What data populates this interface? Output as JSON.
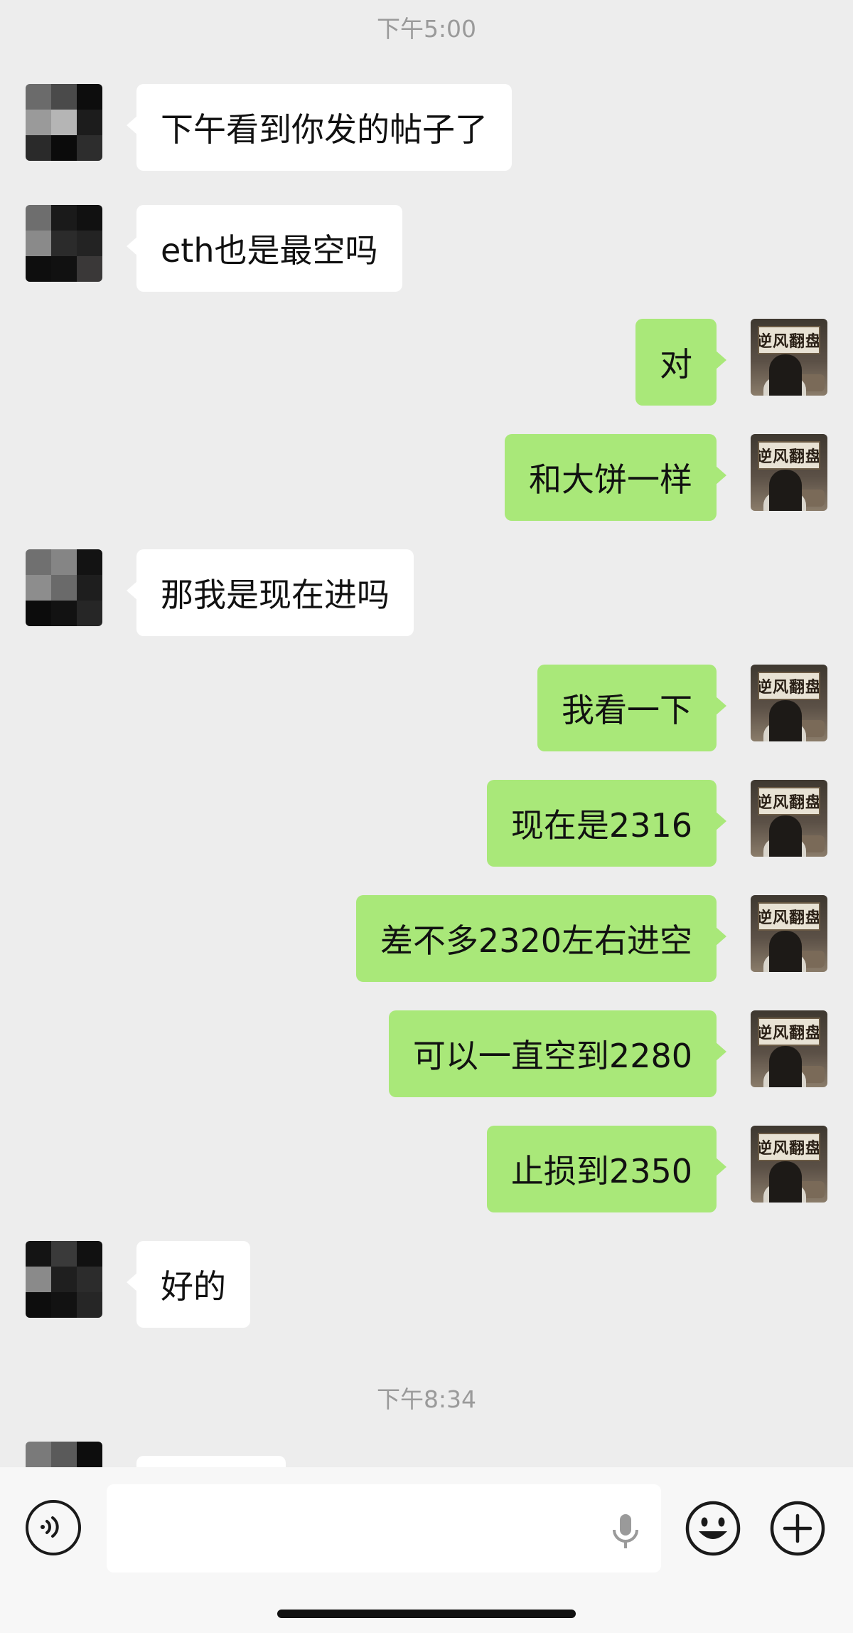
{
  "timestamps": [
    "下午5:00",
    "下午8:34"
  ],
  "messages": [
    {
      "side": "left",
      "text": "下午看到你发的帖子了"
    },
    {
      "side": "left",
      "text": "eth也是最空吗"
    },
    {
      "side": "right",
      "text": "对"
    },
    {
      "side": "right",
      "text": "和大饼一样"
    },
    {
      "side": "left",
      "text": "那我是现在进吗"
    },
    {
      "side": "right",
      "text": "我看一下"
    },
    {
      "side": "right",
      "text": "现在是2316"
    },
    {
      "side": "right",
      "text": "差不多2320左右进空"
    },
    {
      "side": "right",
      "text": "可以一直空到2280"
    },
    {
      "side": "right",
      "text": "止损到2350"
    },
    {
      "side": "left",
      "text": "好的"
    }
  ],
  "self_avatar": {
    "banner_text": "逆风翻盘"
  },
  "input_bar": {
    "icons": [
      "voice-icon",
      "microphone-icon",
      "emoji-icon",
      "plus-icon"
    ],
    "placeholder": ""
  },
  "colors": {
    "background": "#ededed",
    "bubble_self": "#a9e879",
    "bubble_other": "#ffffff",
    "timestamp": "#9a9a9a"
  }
}
